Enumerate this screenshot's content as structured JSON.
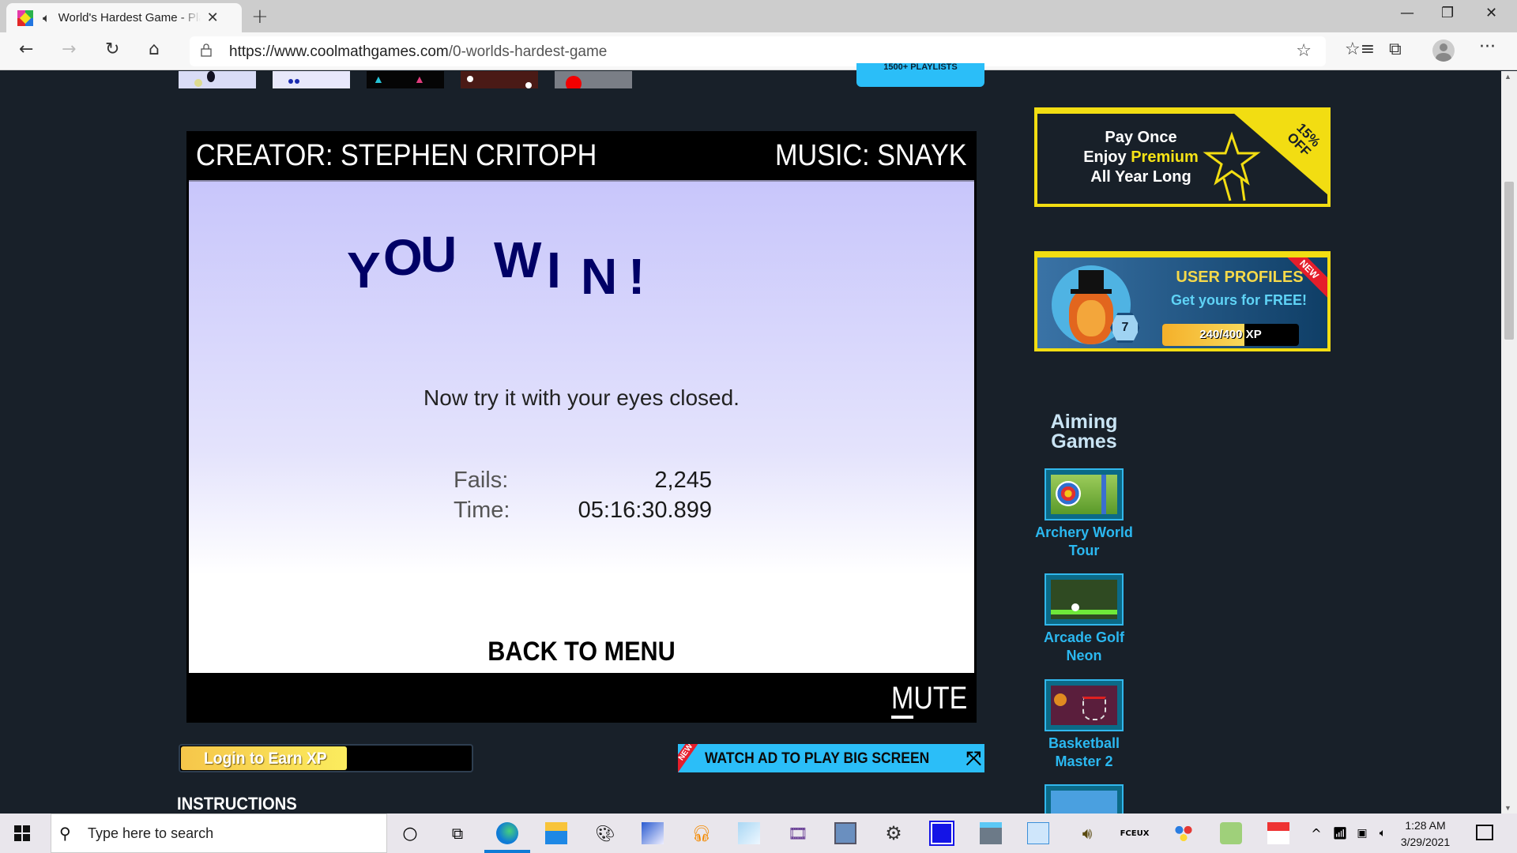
{
  "browser": {
    "tab_title": "World's Hardest Game - Play",
    "tab_audio_icon": "speaker-icon",
    "url_host": "https://www.coolmathgames.com",
    "url_path": "/0-worlds-hardest-game",
    "window_controls": {
      "minimize": "—",
      "restore": "❐",
      "close": "✕"
    },
    "icons": {
      "back": "←",
      "forward": "→",
      "reload": "↻",
      "home": "⌂",
      "favorites_add": "☆",
      "favorites": "☆≡",
      "collections": "⧉",
      "more": "···",
      "new_tab": "+",
      "tab_close": "✕"
    }
  },
  "page": {
    "playlist_button": "1500+ PLAYLISTS",
    "game": {
      "creator": "CREATOR: STEPHEN CRITOPH",
      "music": "MUSIC: SNAYK",
      "win_letters": [
        "Y",
        "O",
        "U",
        "W",
        "I",
        "N",
        "!"
      ],
      "subtitle": "Now try it with your eyes closed.",
      "stats": [
        {
          "label": "Fails:",
          "value": "2,245"
        },
        {
          "label": "Time:",
          "value": "05:16:30.899"
        }
      ],
      "back_to_menu": "BACK TO MENU",
      "mute_first": "M",
      "mute_rest": "UTE"
    },
    "login_bar": {
      "label": "Login to Earn XP",
      "progress": 0.57
    },
    "watch_ad": {
      "badge": "NEW",
      "label": "WATCH AD TO PLAY BIG SCREEN",
      "icon": "expand-icon"
    },
    "instructions_heading": "INSTRUCTIONS"
  },
  "sidebar": {
    "premium_ad": {
      "line1": "Pay Once",
      "line2_prefix": "Enjoy ",
      "line2_highlight": "Premium",
      "line3": "All Year Long",
      "corner": "15% OFF"
    },
    "profiles_ad": {
      "title": "USER PROFILES",
      "subtitle": "Get yours for FREE!",
      "xp_text": "240/400 XP",
      "xp_progress": 0.6,
      "level": "7",
      "badge": "NEW"
    },
    "section_title": "Aiming Games",
    "games": [
      {
        "name": "Archery World Tour"
      },
      {
        "name": "Arcade Golf Neon"
      },
      {
        "name": "Basketball Master 2"
      }
    ],
    "stripe_colors": [
      "#f2dd12",
      "#1e9ad6",
      "#e8403a",
      "#3bb54a"
    ]
  },
  "taskbar": {
    "search_placeholder": "Type here to search",
    "apps": [
      "cortana-icon",
      "task-view-icon",
      "edge-icon",
      "file-explorer-icon",
      "paint-icon",
      "photo-editor-icon",
      "audacity-icon",
      "notepad-icon",
      "video-editor-icon",
      "remote-desktop-icon",
      "settings-icon",
      "app-blue-icon",
      "calculator-icon",
      "control-panel-icon",
      "speaker-app-icon",
      "fceux-icon",
      "color-app-icon",
      "green-app-icon",
      "piano-app-icon"
    ],
    "time": "1:28 AM",
    "date": "3/29/2021"
  }
}
